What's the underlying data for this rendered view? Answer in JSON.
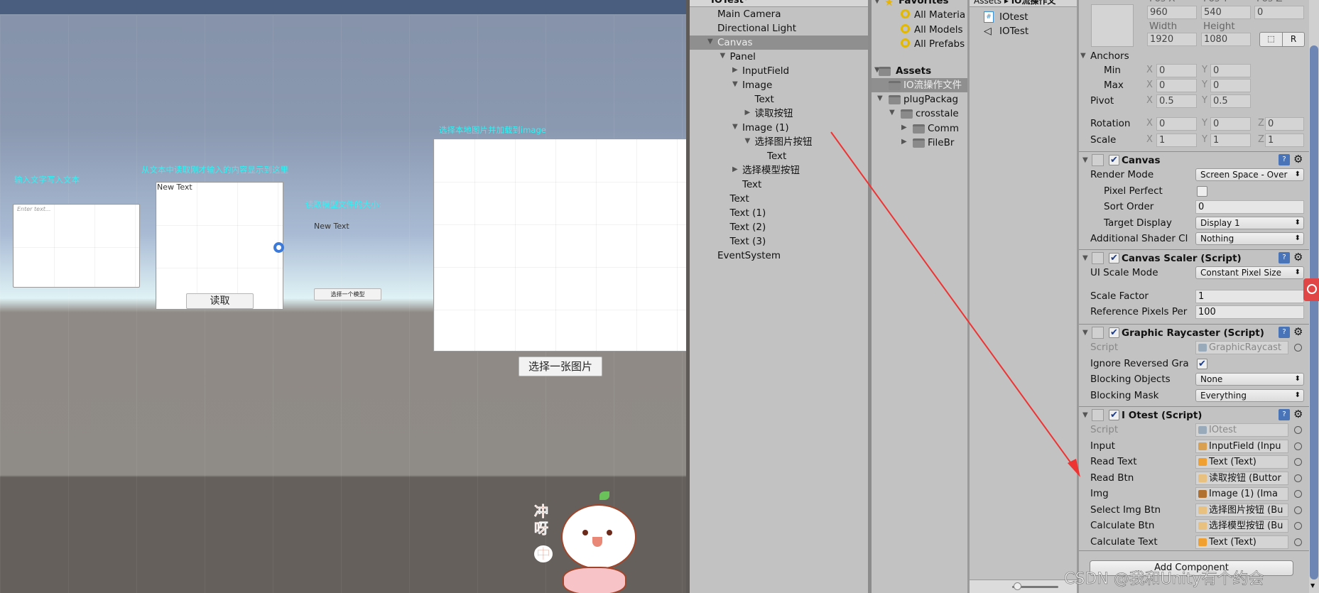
{
  "scene": {
    "label_input": "输入文字写入文本",
    "input_placeholder": "Enter text...",
    "label_read": "从文本中读取刚才输入的内容显示到这里",
    "read_text": "New Text",
    "read_button": "读取",
    "label_model_size": "读取模型文件的大小:",
    "model_text": "New Text",
    "model_button": "选择一个模型",
    "label_image": "选择本地图片并加载到image",
    "image_button": "选择一张图片",
    "sticker_text": [
      "冲",
      "呀",
      "中"
    ],
    "accent_label_color": "#2ff4f6"
  },
  "hierarchy": {
    "title": "IOTest*",
    "items": [
      {
        "label": "Main Camera",
        "depth": 0,
        "arrow": ""
      },
      {
        "label": "Directional Light",
        "depth": 0,
        "arrow": ""
      },
      {
        "label": "Canvas",
        "depth": 0,
        "arrow": "down",
        "selected": true
      },
      {
        "label": "Panel",
        "depth": 1,
        "arrow": "down"
      },
      {
        "label": "InputField",
        "depth": 2,
        "arrow": "right"
      },
      {
        "label": "Image",
        "depth": 2,
        "arrow": "down"
      },
      {
        "label": "Text",
        "depth": 3,
        "arrow": ""
      },
      {
        "label": "读取按钮",
        "depth": 3,
        "arrow": "right"
      },
      {
        "label": "Image (1)",
        "depth": 2,
        "arrow": "down"
      },
      {
        "label": "选择图片按钮",
        "depth": 3,
        "arrow": "down"
      },
      {
        "label": "Text",
        "depth": 4,
        "arrow": ""
      },
      {
        "label": "选择模型按钮",
        "depth": 2,
        "arrow": "right"
      },
      {
        "label": "Text",
        "depth": 2,
        "arrow": ""
      },
      {
        "label": "Text",
        "depth": 1,
        "arrow": ""
      },
      {
        "label": "Text (1)",
        "depth": 1,
        "arrow": ""
      },
      {
        "label": "Text (2)",
        "depth": 1,
        "arrow": ""
      },
      {
        "label": "Text (3)",
        "depth": 1,
        "arrow": ""
      },
      {
        "label": "EventSystem",
        "depth": 0,
        "arrow": ""
      }
    ]
  },
  "project": {
    "favorites_label": "Favorites",
    "favorites": [
      "All Materia",
      "All Models",
      "All Prefabs"
    ],
    "assets_label": "Assets",
    "tree": [
      {
        "label": "IO流操作文件",
        "depth": 1,
        "arrow": "",
        "selected": true
      },
      {
        "label": "plugPackag",
        "depth": 1,
        "arrow": "down"
      },
      {
        "label": "crosstale",
        "depth": 2,
        "arrow": "down"
      },
      {
        "label": "Comm",
        "depth": 3,
        "arrow": "right"
      },
      {
        "label": "FileBr",
        "depth": 3,
        "arrow": "right"
      }
    ],
    "breadcrumb": [
      "Assets",
      "IO流操作文"
    ],
    "files": [
      {
        "label": "IOtest",
        "icon": "csharp-script-icon"
      },
      {
        "label": "IOTest",
        "icon": "unity-scene-icon"
      }
    ],
    "zoom_slider": 0.1
  },
  "inspector": {
    "rect": {
      "pos_labels": [
        "Pos X",
        "Pos Y",
        "Pos Z"
      ],
      "pos": [
        "960",
        "540",
        "0"
      ],
      "size_labels": [
        "Width",
        "Height"
      ],
      "size": [
        "1920",
        "1080"
      ],
      "r_button": "R",
      "anchors": "Anchors",
      "min": "Min",
      "min_vals": [
        "0",
        "0"
      ],
      "max": "Max",
      "max_vals": [
        "0",
        "0"
      ],
      "pivot": "Pivot",
      "pivot_vals": [
        "0.5",
        "0.5"
      ],
      "rotation": "Rotation",
      "rotation_vals": [
        "0",
        "0",
        "0"
      ],
      "scale": "Scale",
      "scale_vals": [
        "1",
        "1",
        "1"
      ],
      "axis": [
        "X",
        "Y",
        "Z"
      ]
    },
    "components": [
      {
        "title": "Canvas",
        "icon": "canvas-icon",
        "enabled": true,
        "rows": [
          {
            "label": "Render Mode",
            "type": "dropdown",
            "value": "Screen Space - Over"
          },
          {
            "label": "Pixel Perfect",
            "type": "checkbox",
            "checked": false,
            "indent": true
          },
          {
            "label": "Sort Order",
            "type": "text",
            "value": "0",
            "indent": true
          },
          {
            "label": "Target Display",
            "type": "dropdown",
            "value": "Display 1",
            "indent": true
          },
          {
            "label": "Additional Shader Cl",
            "type": "dropdown",
            "value": "Nothing"
          }
        ]
      },
      {
        "title": "Canvas Scaler (Script)",
        "icon": "canvas-scaler-icon",
        "enabled": true,
        "rows": [
          {
            "label": "UI Scale Mode",
            "type": "dropdown",
            "value": "Constant Pixel Size"
          },
          {
            "label": "Scale Factor",
            "type": "text",
            "value": "1"
          },
          {
            "label": "Reference Pixels Per",
            "type": "text",
            "value": "100"
          }
        ]
      },
      {
        "title": "Graphic Raycaster (Script)",
        "icon": "graphic-raycaster-icon",
        "enabled": true,
        "rows": [
          {
            "label": "Script",
            "type": "script",
            "value": "GraphicRaycast"
          },
          {
            "label": "Ignore Reversed Gra",
            "type": "checkbox",
            "checked": true
          },
          {
            "label": "Blocking Objects",
            "type": "dropdown",
            "value": "None"
          },
          {
            "label": "Blocking Mask",
            "type": "dropdown",
            "value": "Everything"
          }
        ]
      },
      {
        "title": "I Otest (Script)",
        "icon": "csharp-script-icon",
        "enabled": true,
        "rows": [
          {
            "label": "Script",
            "type": "script",
            "value": "IOtest"
          },
          {
            "label": "Input",
            "type": "object",
            "value": "InputField (Inpu",
            "icon": "inputfield-icon"
          },
          {
            "label": "Read Text",
            "type": "object",
            "value": "Text (Text)",
            "icon": "text-icon"
          },
          {
            "label": "Read Btn",
            "type": "object",
            "value": "读取按钮 (Buttor",
            "icon": "button-icon"
          },
          {
            "label": "Img",
            "type": "object",
            "value": "Image (1) (Ima",
            "icon": "image-icon"
          },
          {
            "label": "Select Img Btn",
            "type": "object",
            "value": "选择图片按钮 (Bu",
            "icon": "button-icon"
          },
          {
            "label": "Calculate Btn",
            "type": "object",
            "value": "选择模型按钮 (Bu",
            "icon": "button-icon"
          },
          {
            "label": "Calculate Text",
            "type": "object",
            "value": "Text (Text)",
            "icon": "text-icon"
          }
        ]
      }
    ],
    "add_component": "Add Component"
  },
  "watermark": "CSDN @我和Unity有个约会",
  "colors": {
    "annotation_arrow": "#ee3333",
    "selection": "#8f8f8f"
  }
}
